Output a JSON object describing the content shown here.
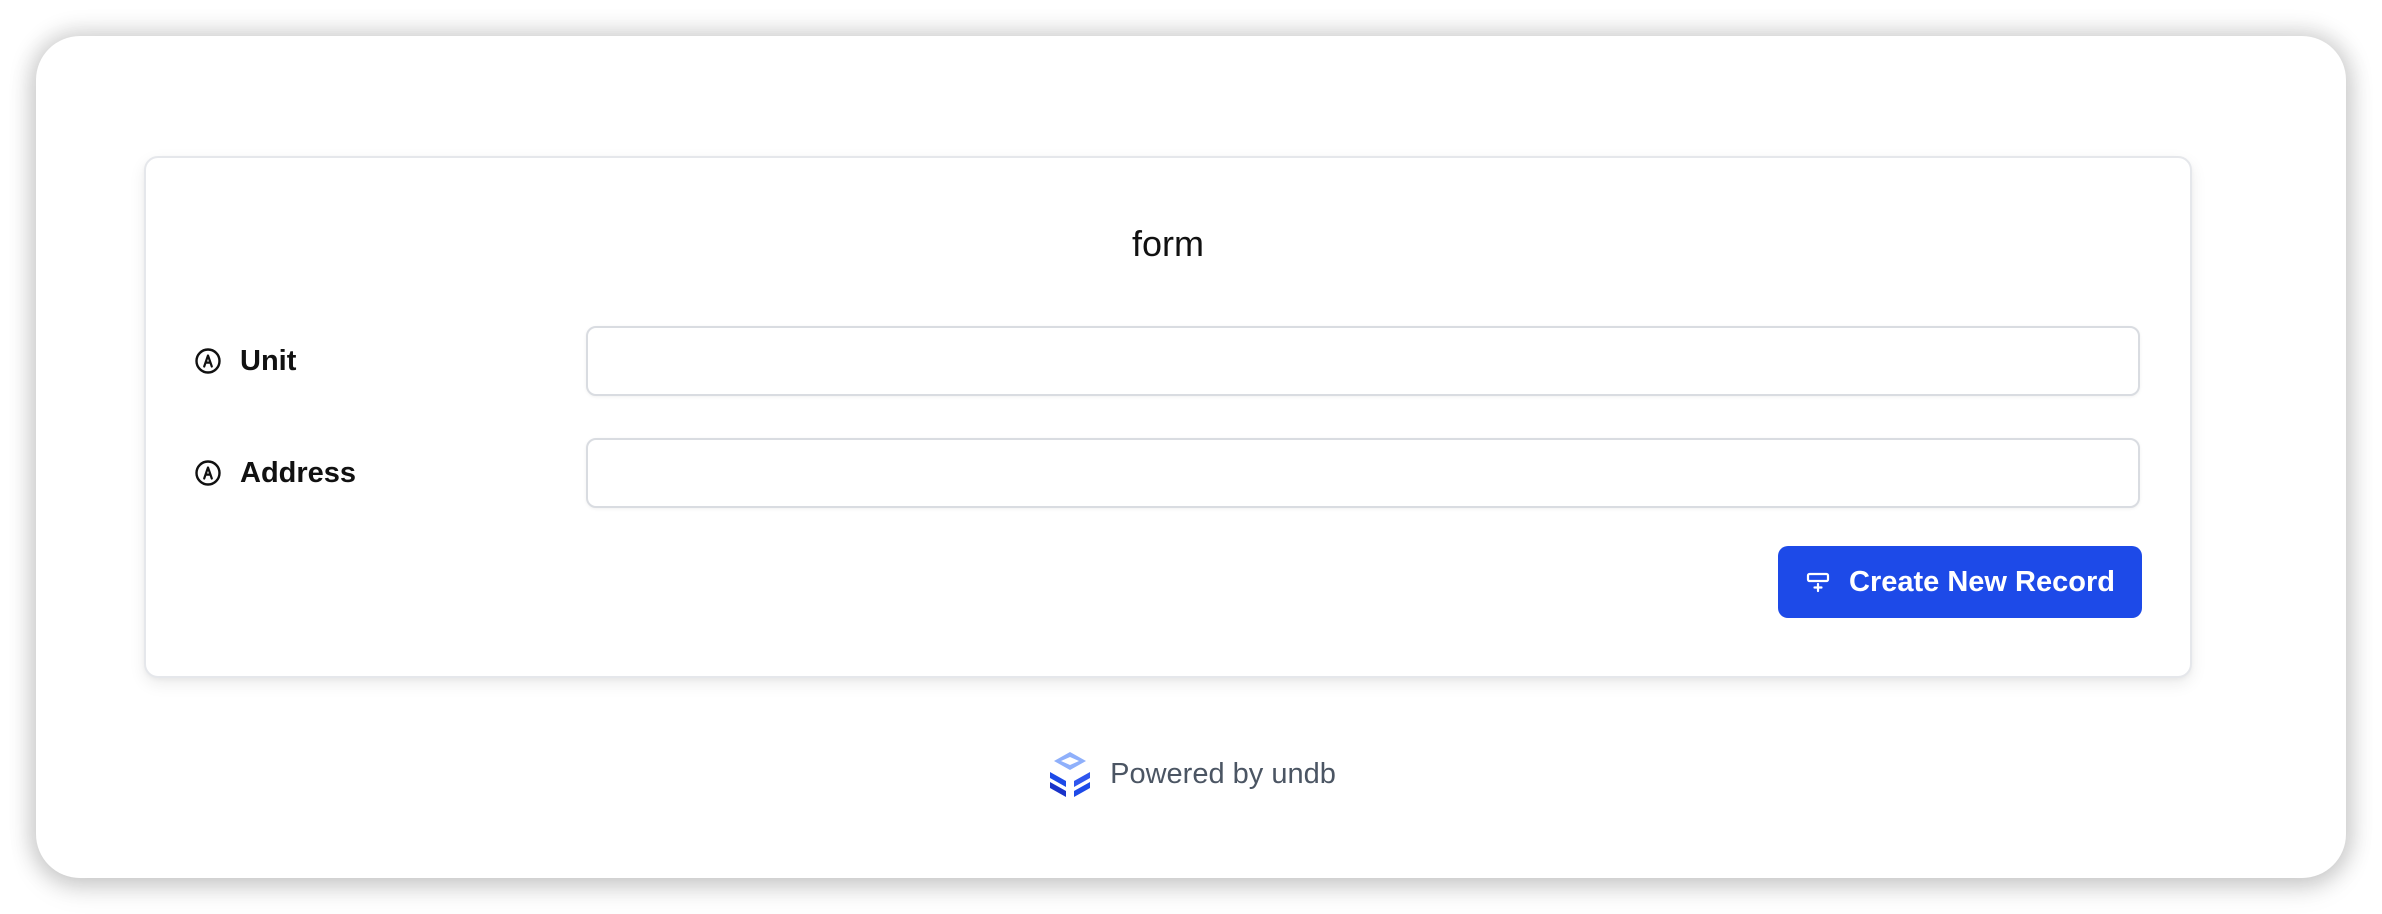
{
  "form": {
    "title": "form",
    "fields": [
      {
        "label": "Unit",
        "value": "",
        "placeholder": "",
        "icon": "string-field-icon"
      },
      {
        "label": "Address",
        "value": "",
        "placeholder": "",
        "icon": "string-field-icon"
      }
    ],
    "submit_label": "Create New Record",
    "submit_icon": "add-record-icon",
    "accent_color": "#1d4ae8"
  },
  "footer": {
    "text": "Powered by undb",
    "logo": "undb-logo-icon"
  }
}
